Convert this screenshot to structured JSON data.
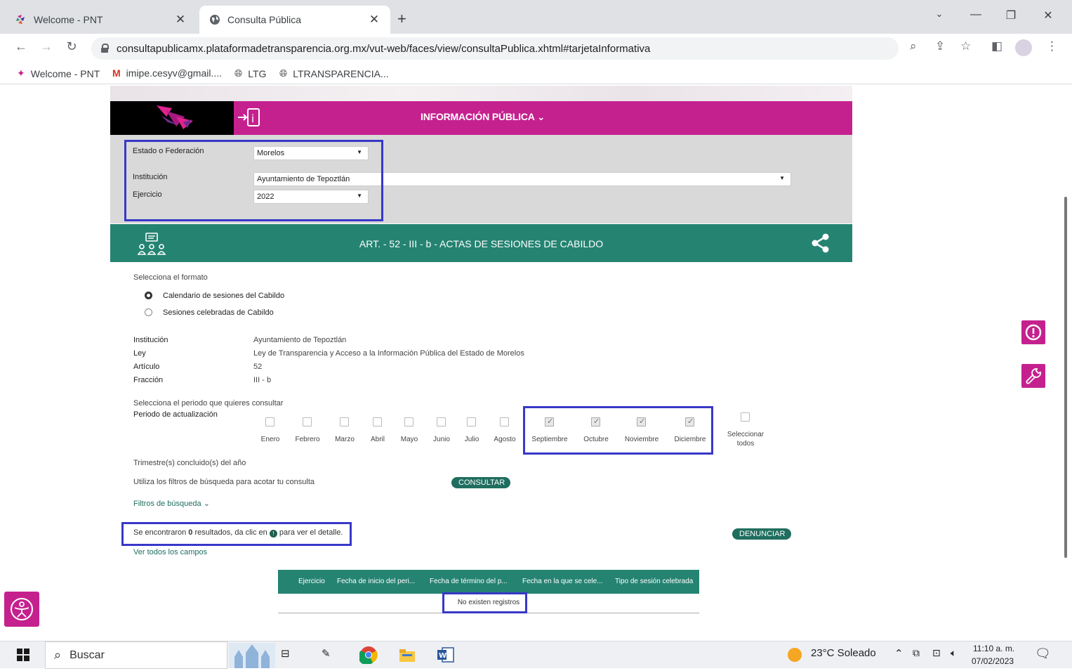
{
  "browser": {
    "tabs": [
      {
        "title": "Welcome - PNT",
        "active": false
      },
      {
        "title": "Consulta Pública",
        "active": true
      }
    ],
    "url": "consultapublicamx.plataformadetransparencia.org.mx/vut-web/faces/view/consultaPublica.xhtml#tarjetaInformativa",
    "bookmarks": [
      "Welcome - PNT",
      "imipe.cesyv@gmail....",
      "LTG",
      "LTRANSPARENCIA..."
    ]
  },
  "header": {
    "menu_label": "INFORMACIÓN PÚBLICA",
    "brand_color": "#c5218e"
  },
  "filters": {
    "estado_label": "Estado o Federación",
    "estado_value": "Morelos",
    "institucion_label": "Institución",
    "institucion_value": "Ayuntamiento de Tepoztlán",
    "ejercicio_label": "Ejercicio",
    "ejercicio_value": "2022"
  },
  "section": {
    "title": "ART. - 52 - III - b - ACTAS DE SESIONES DE CABILDO",
    "color": "#258372"
  },
  "format": {
    "prompt": "Selecciona el formato",
    "options": [
      {
        "label": "Calendario de sesiones del Cabildo",
        "selected": true
      },
      {
        "label": "Sesiones celebradas de Cabildo",
        "selected": false
      }
    ]
  },
  "info": {
    "rows": [
      {
        "label": "Institución",
        "value": "Ayuntamiento de Tepoztlán"
      },
      {
        "label": "Ley",
        "value": "Ley de Transparencia y Acceso a la Información Pública del Estado de Morelos"
      },
      {
        "label": "Artículo",
        "value": "52"
      },
      {
        "label": "Fracción",
        "value": "III - b"
      }
    ]
  },
  "period": {
    "prompt": "Selecciona el periodo que quieres consultar",
    "label": "Periodo de actualización",
    "months": [
      {
        "name": "Enero",
        "checked": false
      },
      {
        "name": "Febrero",
        "checked": false
      },
      {
        "name": "Marzo",
        "checked": false
      },
      {
        "name": "Abril",
        "checked": false
      },
      {
        "name": "Mayo",
        "checked": false
      },
      {
        "name": "Junio",
        "checked": false
      },
      {
        "name": "Julio",
        "checked": false
      },
      {
        "name": "Agosto",
        "checked": false
      },
      {
        "name": "Septiembre",
        "checked": true
      },
      {
        "name": "Octubre",
        "checked": true
      },
      {
        "name": "Noviembre",
        "checked": true
      },
      {
        "name": "Diciembre",
        "checked": true
      }
    ],
    "select_all_line1": "Seleccionar",
    "select_all_line2": "todos",
    "trimestre_text": "Trimestre(s) concluido(s) del año"
  },
  "search": {
    "hint": "Utiliza los filtros de búsqueda para acotar tu consulta",
    "consultar_label": "CONSULTAR",
    "filters_link": "Filtros de búsqueda"
  },
  "results": {
    "prefix": "Se encontraron ",
    "count": "0",
    "middle": " resultados, da clic en ",
    "suffix": " para ver el detalle.",
    "denunciar_label": "DENUNCIAR",
    "ver_todos": "Ver todos los campos"
  },
  "table": {
    "columns": [
      "Ejercicio",
      "Fecha de inicio del peri...",
      "Fecha de término del p...",
      "Fecha en la que se cele...",
      "Tipo de sesión celebrada"
    ],
    "empty_message": "No existen registros"
  },
  "taskbar": {
    "search_placeholder": "Buscar",
    "weather": "23°C  Soleado",
    "time": "11:10 a. m.",
    "date": "07/02/2023"
  },
  "highlight_color": "#3838c8"
}
